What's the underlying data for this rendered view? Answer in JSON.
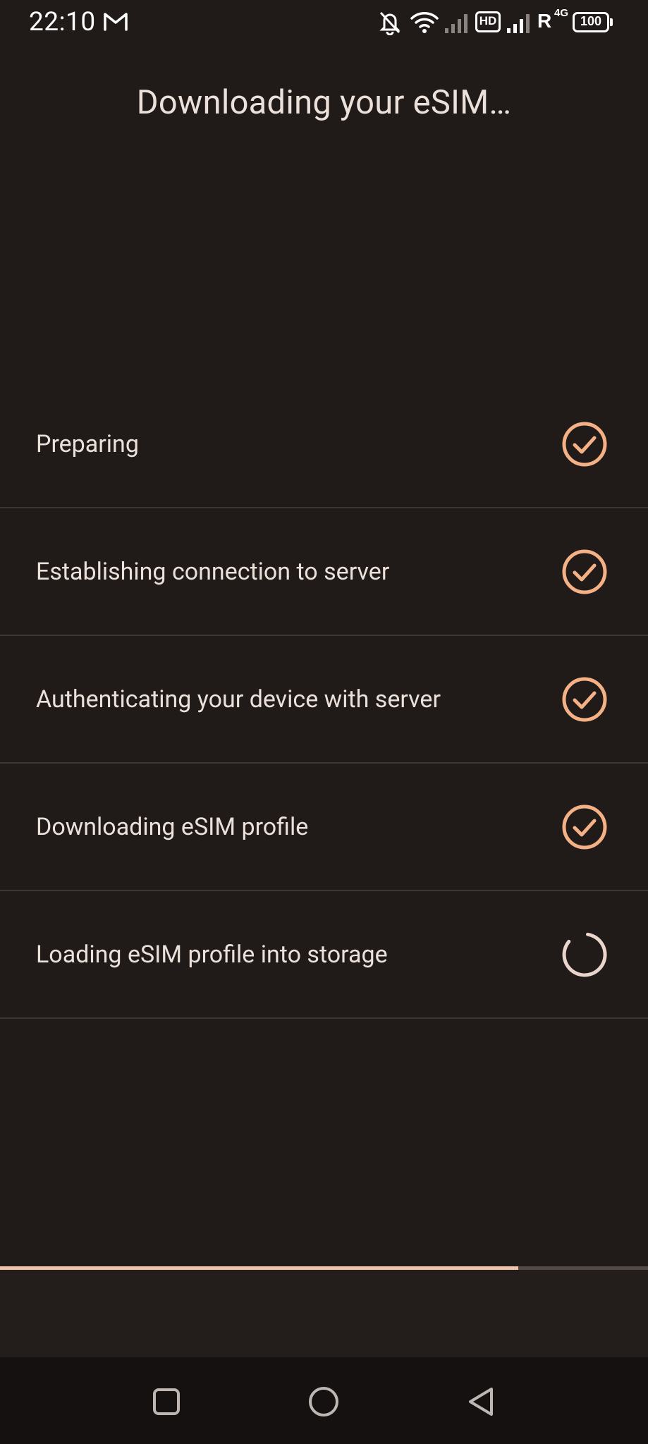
{
  "status_bar": {
    "time": "22:10",
    "network_hd": "HD",
    "roaming": "R",
    "network_type": "4G",
    "battery": "100"
  },
  "title": "Downloading your eSIM…",
  "steps": [
    {
      "label": "Preparing",
      "state": "done",
      "icon": "check-circle-icon"
    },
    {
      "label": "Establishing connection to server",
      "state": "done",
      "icon": "check-circle-icon"
    },
    {
      "label": "Authenticating your device with server",
      "state": "done",
      "icon": "check-circle-icon"
    },
    {
      "label": "Downloading eSIM profile",
      "state": "done",
      "icon": "check-circle-icon"
    },
    {
      "label": "Loading eSIM profile into storage",
      "state": "in-progress",
      "icon": "spinner-icon"
    }
  ],
  "progress": {
    "fraction": 0.8
  },
  "colors": {
    "background": "#201b19",
    "accent": "#f4b186",
    "text": "#ebe0da",
    "divider": "#3e3633"
  }
}
